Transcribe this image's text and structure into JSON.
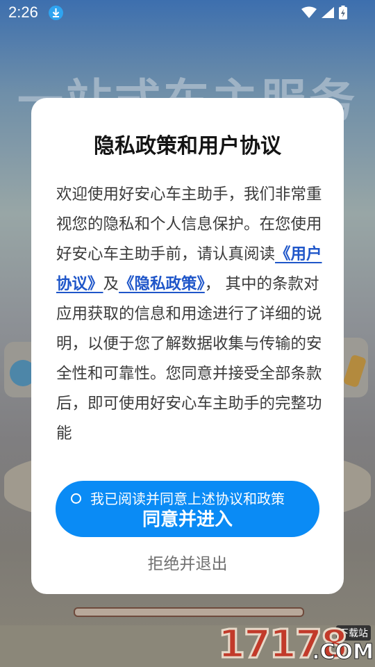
{
  "status_bar": {
    "time": "2:26",
    "icons": [
      "download-icon",
      "wifi-icon",
      "signal-icon",
      "battery-icon"
    ]
  },
  "background": {
    "banner_title": "一站式车主服务"
  },
  "dialog": {
    "title": "隐私政策和用户协议",
    "body": {
      "part1": "欢迎使用好安心车主助手，我们非常重视您的隐私和个人信息保护。在您使用好安心车主助手前，请认真阅读",
      "user_agreement_link": "《用户协议》",
      "and": "及",
      "privacy_policy_link": "《隐私政策》",
      "part2": "， 其中的条款对应用获取的信息和用途进行了详细的说明，以便于您了解数据收集与传输的安全性和可靠性。您同意并接受全部条款后，即可使用好安心车主助手的完整功能"
    },
    "agree_checkbox_label": "我已阅读并同意上述协议和政策",
    "agree_button_label": "同意并进入",
    "refuse_label": "拒绝并退出"
  },
  "watermark": {
    "number": "17178",
    "domain": ".COM",
    "tag": "下载站"
  },
  "colors": {
    "accent": "#0a8bf5",
    "link": "#1f56c9",
    "dialog_bg": "#ffffff"
  }
}
